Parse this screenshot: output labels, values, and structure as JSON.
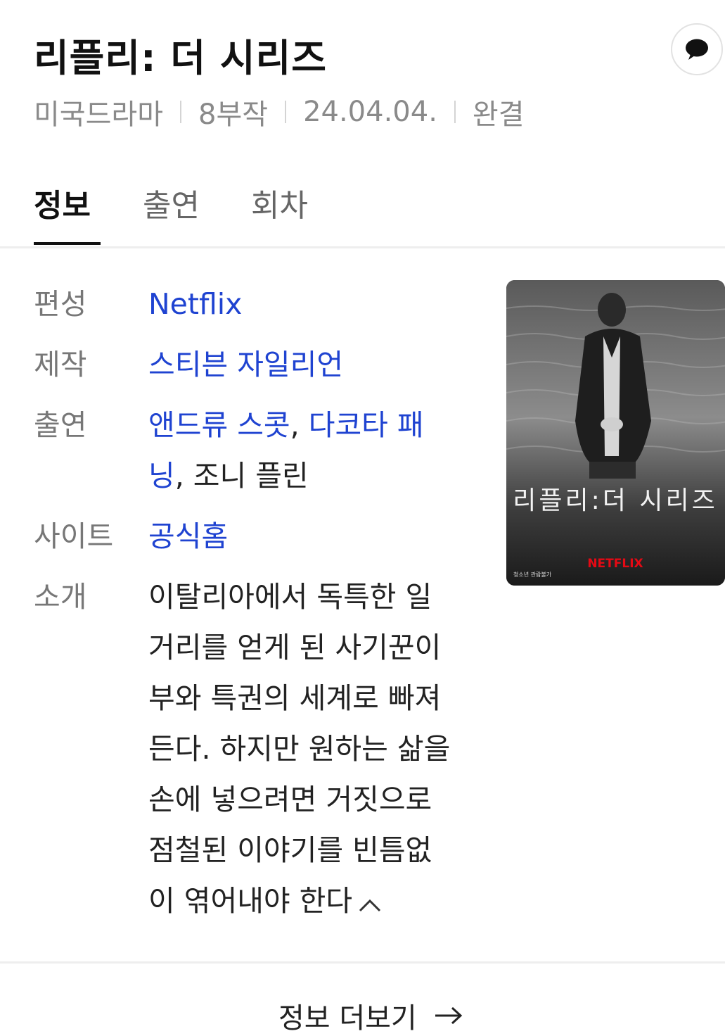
{
  "header": {
    "title": "리플리: 더 시리즈",
    "meta": [
      "미국드라마",
      "8부작",
      "24.04.04.",
      "완결"
    ]
  },
  "tabs": [
    {
      "label": "정보",
      "active": true
    },
    {
      "label": "출연",
      "active": false
    },
    {
      "label": "회차",
      "active": false
    }
  ],
  "info": {
    "network_label": "편성",
    "network_value": "Netflix",
    "production_label": "제작",
    "production_value": "스티븐 자일리언",
    "cast_label": "출연",
    "cast": [
      {
        "name": "앤드류 스콧",
        "link": true
      },
      {
        "name": "다코타 패닝",
        "link": true
      },
      {
        "name": "조니 플린",
        "link": false
      }
    ],
    "cast_line1_a": "앤드류 스콧",
    "cast_line1_sep": ", ",
    "cast_line1_b": "다코타 패",
    "cast_line2_a": "닝",
    "cast_line2_rest": ", 조니 플린",
    "site_label": "사이트",
    "site_value": "공식홈",
    "intro_label": "소개",
    "intro_lines": [
      "이탈리아에서 독특한 일",
      "거리를 얻게 된 사기꾼이",
      "부와 특권의 세계로 빠져",
      "든다. 하지만 원하는 삶을",
      "손에 넣으려면 거짓으로",
      "점철된 이야기를 빈틈없",
      "이 엮어내야 한다"
    ]
  },
  "poster": {
    "title_text": "리플리:더 시리즈",
    "brand": "NETFLIX",
    "small_caption": "청소년 관람불가",
    "brand_color": "#e50914"
  },
  "footer": {
    "more_label": "정보 더보기"
  },
  "icons": {
    "chat": "chat-bubble-icon",
    "collapse": "chevron-up-icon",
    "more": "arrow-right-icon"
  },
  "colors": {
    "link": "#1f43d1",
    "muted": "#8a8a8a",
    "label": "#777777"
  }
}
